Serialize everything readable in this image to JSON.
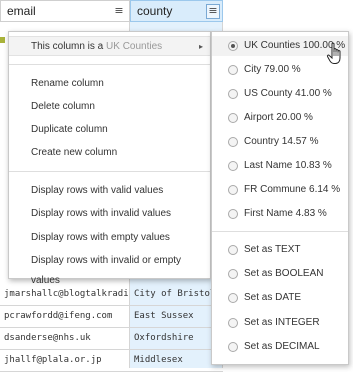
{
  "grid": {
    "columns": [
      {
        "name": "email",
        "menu_icon": "≡"
      },
      {
        "name": "county",
        "menu_icon": "≡"
      }
    ],
    "rows": [
      {
        "email": "jmarshallc@blogtalkradio.com",
        "county": "City of Bristol"
      },
      {
        "email": "pcrawfordd@ifeng.com",
        "county": "East Sussex"
      },
      {
        "email": "dsanderse@nhs.uk",
        "county": "Oxfordshire"
      },
      {
        "email": "jhallf@plala.or.jp",
        "county": "Middlesex"
      }
    ]
  },
  "menu": {
    "type_item": {
      "prefix": "This column is a ",
      "type": "UK Counties",
      "arrow": "▸"
    },
    "column_actions": [
      "Rename column",
      "Delete column",
      "Duplicate column",
      "Create new column"
    ],
    "display_actions": [
      "Display rows with valid values",
      "Display rows with invalid values",
      "Display rows with empty values",
      "Display rows with invalid or empty values"
    ]
  },
  "submenu": {
    "types": [
      {
        "label": "UK Counties 100.00 %",
        "checked": true
      },
      {
        "label": "City 79.00 %",
        "checked": false
      },
      {
        "label": "US County 41.00 %",
        "checked": false
      },
      {
        "label": "Airport 20.00 %",
        "checked": false
      },
      {
        "label": "Country 14.57 %",
        "checked": false
      },
      {
        "label": "Last Name 10.83 %",
        "checked": false
      },
      {
        "label": "FR Commune 6.14 %",
        "checked": false
      },
      {
        "label": "First Name 4.83 %",
        "checked": false
      }
    ],
    "set_as": [
      "Set as TEXT",
      "Set as BOOLEAN",
      "Set as DATE",
      "Set as INTEGER",
      "Set as DECIMAL"
    ]
  },
  "colors": {
    "selected_column_bg": "#d9ecfb",
    "menu_border": "#c9c9c9"
  }
}
